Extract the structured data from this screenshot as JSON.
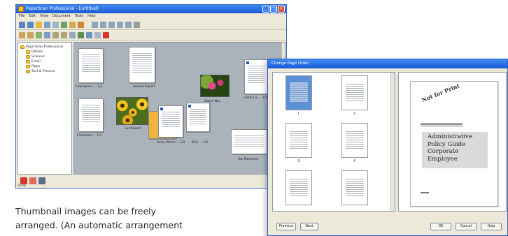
{
  "main_window": {
    "title": "PaperScan Professional - [untitled]",
    "menu": [
      "File",
      "Edit",
      "View",
      "Document",
      "Tools",
      "Help"
    ],
    "tree": {
      "root": "PaperScan Professional",
      "items": [
        "Details",
        "Scanner",
        "Email",
        "Paper",
        "Sort & Process"
      ]
    },
    "thumbnails": [
      {
        "label": "Employees ... 1/3"
      },
      {
        "label": "Annual Report"
      },
      {
        "label": "Water Mas"
      },
      {
        "label": "Letters & ... 1/2"
      },
      {
        "label": "Flowchart ... 1/1"
      },
      {
        "label": "Sunflowers"
      },
      {
        "label": "Sales Memo ... 1/2"
      },
      {
        "label": "Bills ... 1/2"
      },
      {
        "label": "Fax Machines"
      }
    ],
    "status": "Ready"
  },
  "dialog": {
    "title": "Change Page Order",
    "page_numbers": [
      "1",
      "2",
      "3",
      "4"
    ],
    "preview": {
      "lines": [
        "Administrative",
        "Policy Guide",
        "Corporate",
        "Employee"
      ]
    },
    "buttons": {
      "previous": "Previous",
      "next": "Next",
      "ok": "OK",
      "cancel": "Cancel",
      "help": "Help"
    }
  },
  "caption": {
    "line1": "Thumbnail images can be freely",
    "line2": "arranged. (An automatic arrangement"
  },
  "colors": {
    "titlebar": "#1a58d6",
    "canvas_bg": "#aab3bb",
    "selection": "#5b8fd6"
  }
}
